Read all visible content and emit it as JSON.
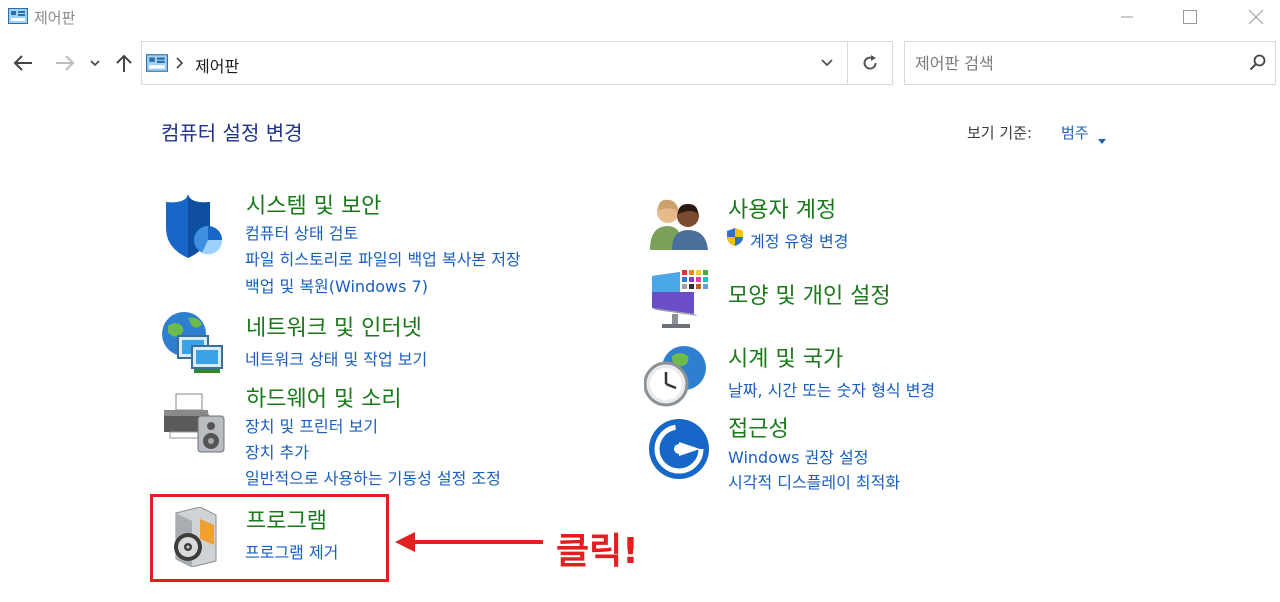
{
  "window": {
    "title": "제어판",
    "icon": "control-panel-icon"
  },
  "address": {
    "path_label": "제어판"
  },
  "search": {
    "placeholder": "제어판 검색"
  },
  "content": {
    "title": "컴퓨터 설정 변경",
    "view_by_label": "보기 기준:",
    "view_by_value": "범주"
  },
  "categories": [
    {
      "icon": "system-security-shield-icon",
      "title": "시스템 및 보안",
      "links": [
        "컴퓨터 상태 검토",
        "파일 히스토리로 파일의 백업 복사본 저장",
        "백업 및 복원(Windows 7)"
      ]
    },
    {
      "icon": "network-globe-icon",
      "title": "네트워크 및 인터넷",
      "links": [
        "네트워크 상태 및 작업 보기"
      ]
    },
    {
      "icon": "printer-speaker-icon",
      "title": "하드웨어 및 소리",
      "links": [
        "장치 및 프린터 보기",
        "장치 추가",
        "일반적으로 사용하는 기동성 설정 조정"
      ]
    },
    {
      "icon": "programs-disc-icon",
      "title": "프로그램",
      "links": [
        "프로그램 제거"
      ]
    },
    {
      "icon": "user-accounts-icon",
      "title": "사용자 계정",
      "links": [
        "계정 유형 변경"
      ]
    },
    {
      "icon": "appearance-monitor-icon",
      "title": "모양 및 개인 설정",
      "links": []
    },
    {
      "icon": "clock-region-icon",
      "title": "시계 및 국가",
      "links": [
        "날짜, 시간 또는 숫자 형식 변경"
      ]
    },
    {
      "icon": "ease-of-access-icon",
      "title": "접근성",
      "links": [
        "Windows 권장 설정",
        "시각적 디스플레이 최적화"
      ]
    }
  ],
  "annotation": {
    "text": "클릭!",
    "color": "#e31e1e"
  },
  "colors": {
    "category_title": "#1a7a1a",
    "link": "#1a5fbf",
    "page_title": "#1e3287"
  }
}
